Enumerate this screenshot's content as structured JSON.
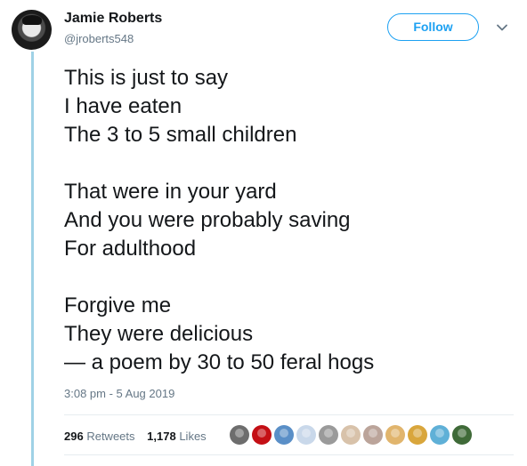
{
  "user": {
    "name": "Jamie Roberts",
    "handle": "@jroberts548",
    "avatar_icon": "user-avatar-icon"
  },
  "follow_button": {
    "label": "Follow"
  },
  "menu": {
    "icon": "chevron-down-icon"
  },
  "poem": {
    "stanzas": [
      [
        "This is just to say",
        "I have eaten",
        "The 3 to 5 small children"
      ],
      [
        "That were in your yard",
        "And you were probably saving",
        "For adulthood"
      ],
      [
        "Forgive me",
        "They were delicious",
        "— a poem by 30 to 50 feral hogs"
      ]
    ]
  },
  "timestamp": "3:08 pm - 5 Aug 2019",
  "stats": {
    "retweets_count": "296",
    "retweets_label": "Retweets",
    "likes_count": "1,178",
    "likes_label": "Likes"
  },
  "likers": [
    {
      "name": "liker-1",
      "color": "#6d6d6d"
    },
    {
      "name": "liker-2",
      "color": "#c40f15"
    },
    {
      "name": "liker-3",
      "color": "#5a8fc7"
    },
    {
      "name": "liker-4",
      "color": "#c9d8ea"
    },
    {
      "name": "liker-5",
      "color": "#9a9a9a"
    },
    {
      "name": "liker-6",
      "color": "#d8c2aa"
    },
    {
      "name": "liker-7",
      "color": "#bba49a"
    },
    {
      "name": "liker-8",
      "color": "#e1b56d"
    },
    {
      "name": "liker-9",
      "color": "#d9a63c"
    },
    {
      "name": "liker-10",
      "color": "#5fb0d7"
    },
    {
      "name": "liker-11",
      "color": "#3f6a38"
    }
  ],
  "colors": {
    "accent": "#1da1f2",
    "thread_line": "#9fd2e6",
    "muted": "#657786"
  }
}
